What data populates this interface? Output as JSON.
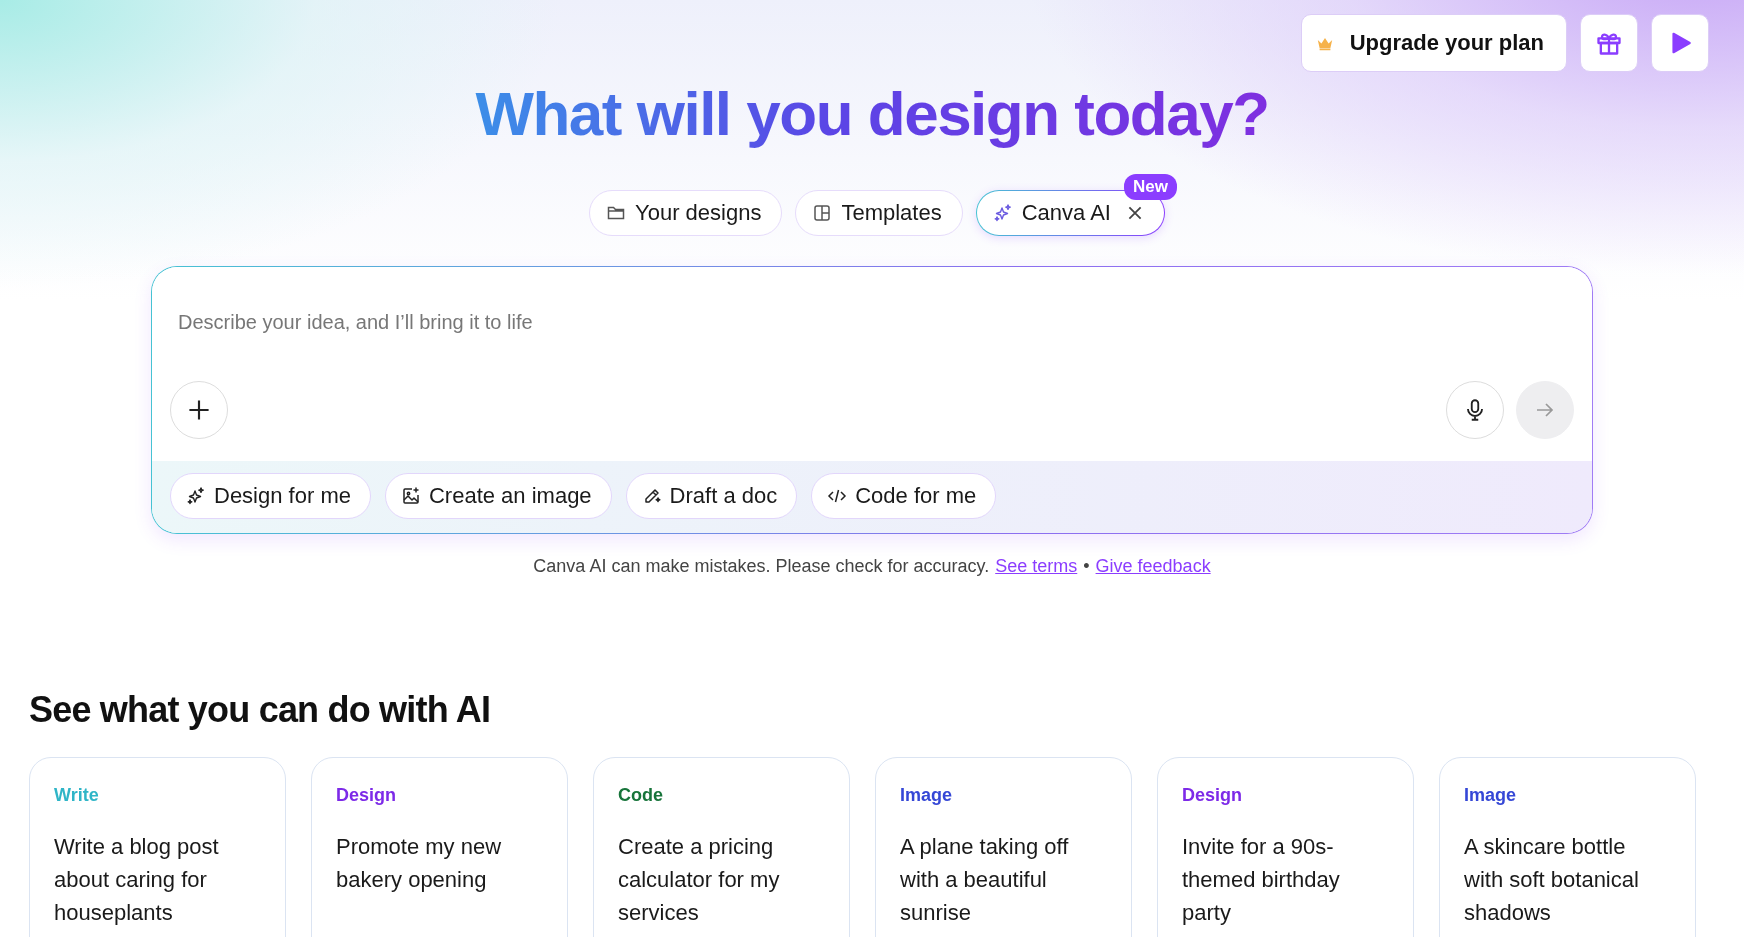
{
  "top_bar": {
    "upgrade_label": "Upgrade your plan"
  },
  "title": "What will you design today?",
  "tabs": [
    {
      "label": "Your designs",
      "selected": false
    },
    {
      "label": "Templates",
      "selected": false
    },
    {
      "label": "Canva AI",
      "selected": true,
      "badge": "New"
    }
  ],
  "prompt": {
    "placeholder": "Describe your idea, and I’ll bring it to life"
  },
  "chips": [
    {
      "label": "Design for me"
    },
    {
      "label": "Create an image"
    },
    {
      "label": "Draft a doc"
    },
    {
      "label": "Code for me"
    }
  ],
  "disclaimer": {
    "text": "Canva AI can make mistakes. Please check for accuracy.",
    "links": [
      "See terms",
      "Give feedback"
    ],
    "separator": "•"
  },
  "section_title": "See what you can do with AI",
  "cards": [
    {
      "category": "Write",
      "color": "#2fb5c7",
      "text": "Write a blog post about caring for houseplants"
    },
    {
      "category": "Design",
      "color": "#7d2ae8",
      "text": "Promote my new bakery opening"
    },
    {
      "category": "Code",
      "color": "#17743a",
      "text": "Create a pricing calculator for my services"
    },
    {
      "category": "Image",
      "color": "#3547d6",
      "text": "A plane taking off with a beautiful sunrise"
    },
    {
      "category": "Design",
      "color": "#7d2ae8",
      "text": "Invite for a 90s-themed birthday party"
    },
    {
      "category": "Image",
      "color": "#3547d6",
      "text": "A skincare bottle with soft botanical shadows"
    }
  ]
}
